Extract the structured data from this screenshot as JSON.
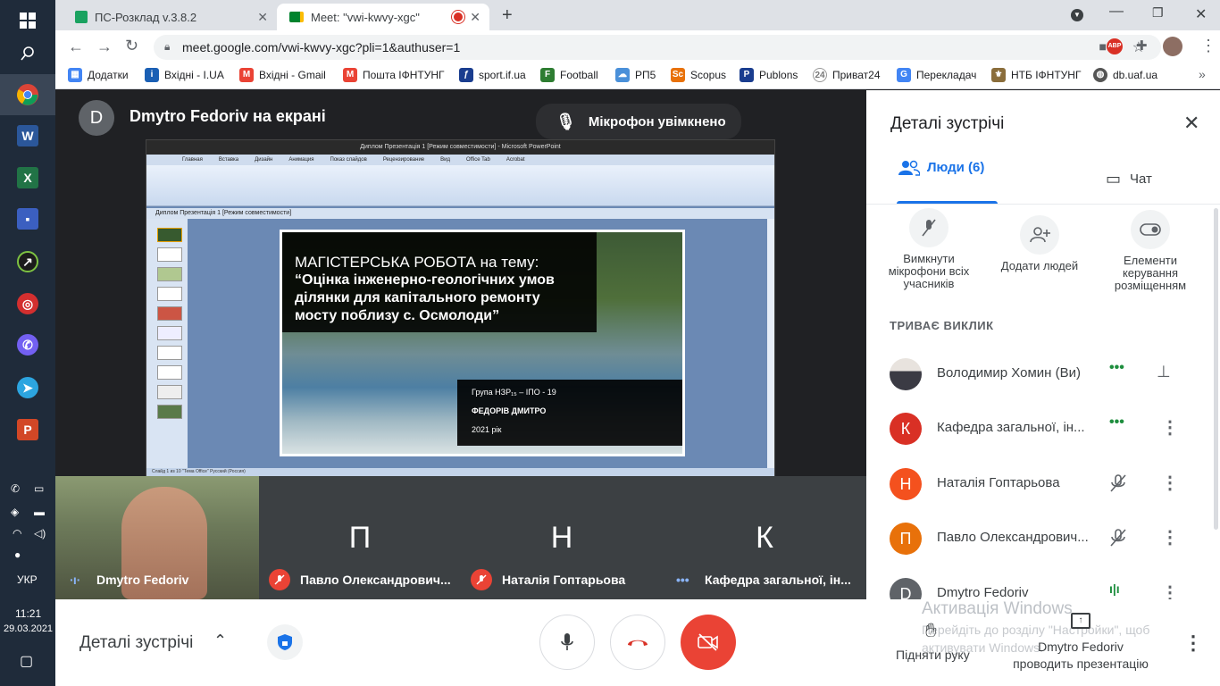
{
  "taskbar": {
    "language": "УКР",
    "time": "11:21",
    "date": "29.03.2021"
  },
  "browser": {
    "tabs": [
      {
        "title": "ПС-Розклад v.3.8.2"
      },
      {
        "title": "Meet: \"vwi-kwvy-xgc\""
      }
    ],
    "url": "meet.google.com/vwi-kwvy-xgc?pli=1&authuser=1",
    "bookmarks": [
      {
        "label": "Додатки",
        "color": "#4285f4"
      },
      {
        "label": "Вхідні - I.UA",
        "color": "#1a5fb4"
      },
      {
        "label": "Вхідні - Gmail",
        "color": "#ea4335"
      },
      {
        "label": "Пошта ІФНТУНГ",
        "color": "#ea4335"
      },
      {
        "label": "sport.if.ua",
        "color": "#1a3d8f"
      },
      {
        "label": "Football",
        "color": "#2e7d32"
      },
      {
        "label": "РП5",
        "color": "#4a90d9"
      },
      {
        "label": "Scopus",
        "color": "#e8710a"
      },
      {
        "label": "Publons",
        "color": "#1a3d8f"
      },
      {
        "label": "Приват24",
        "color": "#777"
      },
      {
        "label": "Перекладач",
        "color": "#4285f4"
      },
      {
        "label": "НТБ ІФНТУНГ",
        "color": "#8a6d3b"
      },
      {
        "label": "db.uaf.ua",
        "color": "#555"
      }
    ]
  },
  "meet": {
    "presenter_initial": "D",
    "presenter_title": "Dmytro Fedoriv на екрані",
    "mic_status": "Мікрофон увімкнено",
    "slide": {
      "line1": "МАГІСТЕРСЬКА РОБОТА на тему:",
      "line2": "“Оцінка інженерно-геологічних умов",
      "line3": "ділянки для капітального ремонту",
      "line4": "мосту поблизу с. Осмолоди”",
      "group": "Група НЗР₁₅ – ІПО - 19",
      "author": "ФЕДОРІВ ДМИТРО",
      "year": "2021 рік",
      "window_title": "Диплом Презентація 1 [Режим совместимости] - Microsoft PowerPoint",
      "doc_tab": "Диплом Презентація 1 [Режим совместимости]",
      "status": "Слайд 1 из 10   \"Тема Office\"   Русский (Россия)",
      "ribbon_tabs": [
        "Главная",
        "Вставка",
        "Дизайн",
        "Анимация",
        "Показ слайдов",
        "Рецензирование",
        "Вид",
        "Office Tab",
        "Acrobat"
      ]
    },
    "tiles": [
      {
        "name": "Dmytro Fedoriv",
        "initial": "",
        "color": "#6d7a5a"
      },
      {
        "name": "Павло Олександрович...",
        "initial": "П",
        "color": "#e8710a"
      },
      {
        "name": "Наталія Гоптарьова",
        "initial": "Н",
        "color": "#f4511e"
      },
      {
        "name": "Кафедра загальної, ін...",
        "initial": "К",
        "color": "#d93025"
      }
    ],
    "bottom": {
      "details_label": "Деталі зустрічі",
      "raise_hand": "Підняти руку",
      "presenting_line1": "Dmytro Fedoriv",
      "presenting_line2": "проводить презентацію",
      "watermark_title": "Активація Windows",
      "watermark_text": "Перейдіть до розділу \"Настройки\", щоб активувати Windows."
    }
  },
  "panel": {
    "title": "Деталі зустрічі",
    "tab_people": "Люди (6)",
    "tab_chat": "Чат",
    "actions": [
      {
        "label": "Вимкнути мікрофони всіх учасників"
      },
      {
        "label": "Додати людей"
      },
      {
        "label": "Елементи керування розміщенням"
      }
    ],
    "section": "ТРИВАЄ ВИКЛИК",
    "people": [
      {
        "name": "Володимир Хомин (Ви)",
        "initial": "",
        "color": "#555"
      },
      {
        "name": "Кафедра загальної, ін...",
        "initial": "К",
        "color": "#d93025"
      },
      {
        "name": "Наталія Гоптарьова",
        "initial": "Н",
        "color": "#f4511e"
      },
      {
        "name": "Павло Олександрович...",
        "initial": "П",
        "color": "#e8710a"
      },
      {
        "name": "Dmytro Fedoriv",
        "initial": "D",
        "color": "#5f6368"
      }
    ]
  }
}
